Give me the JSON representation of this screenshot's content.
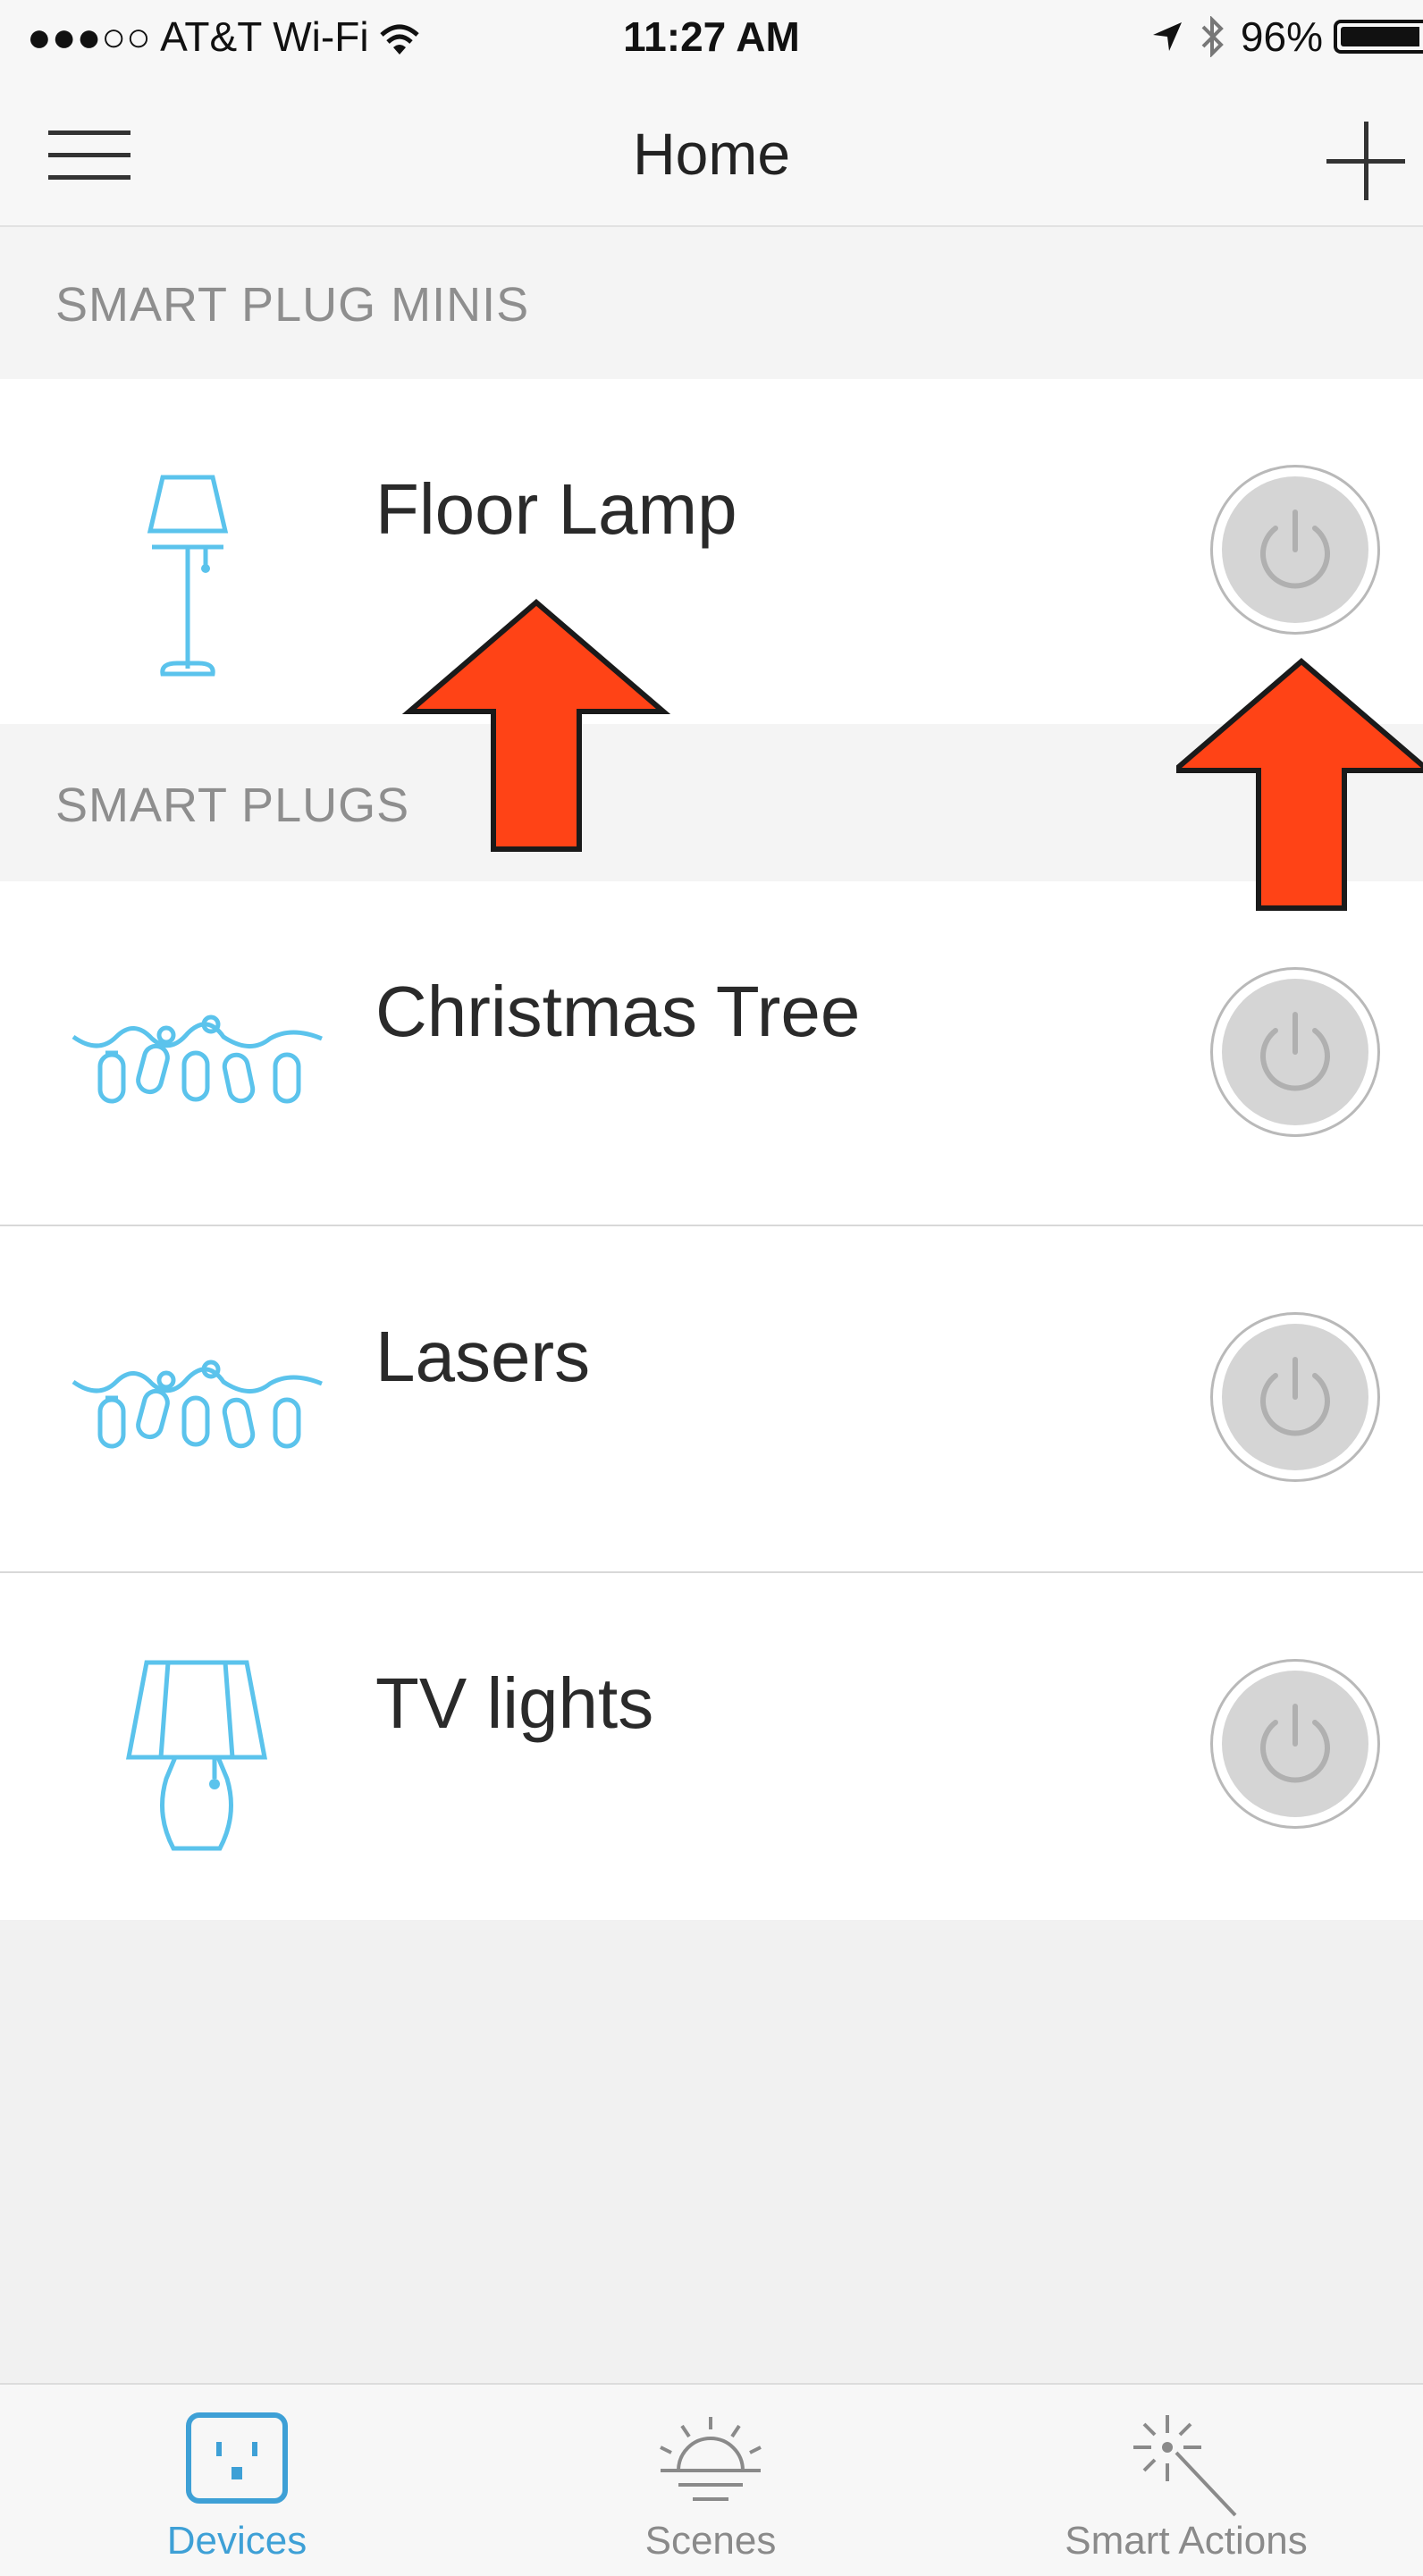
{
  "status_bar": {
    "carrier": "●●●○○ AT&T Wi-Fi ",
    "time": "11:27 AM",
    "battery": "96%"
  },
  "nav": {
    "title": "Home",
    "menu_icon": "hamburger-menu-icon",
    "add_icon": "plus-icon"
  },
  "sections": [
    {
      "label": "SMART PLUG MINIS",
      "devices": [
        {
          "name": "Floor Lamp",
          "icon": "floor-lamp-icon",
          "state": "off"
        }
      ]
    },
    {
      "label": "SMART PLUGS",
      "devices": [
        {
          "name": "Christmas Tree",
          "icon": "string-lights-icon",
          "state": "off"
        },
        {
          "name": "Lasers",
          "icon": "string-lights-icon",
          "state": "off"
        },
        {
          "name": "TV lights",
          "icon": "table-lamp-icon",
          "state": "off"
        }
      ]
    }
  ],
  "tabs": [
    {
      "label": "Devices",
      "icon": "outlet-icon",
      "active": true
    },
    {
      "label": "Scenes",
      "icon": "sunrise-icon",
      "active": false
    },
    {
      "label": "Smart Actions",
      "icon": "magic-wand-icon",
      "active": false
    }
  ],
  "colors": {
    "accent": "#3ea0d6",
    "icon_blue": "#5bc3ec",
    "arrow": "#ff4316",
    "power_off": "#d5d5d5"
  }
}
